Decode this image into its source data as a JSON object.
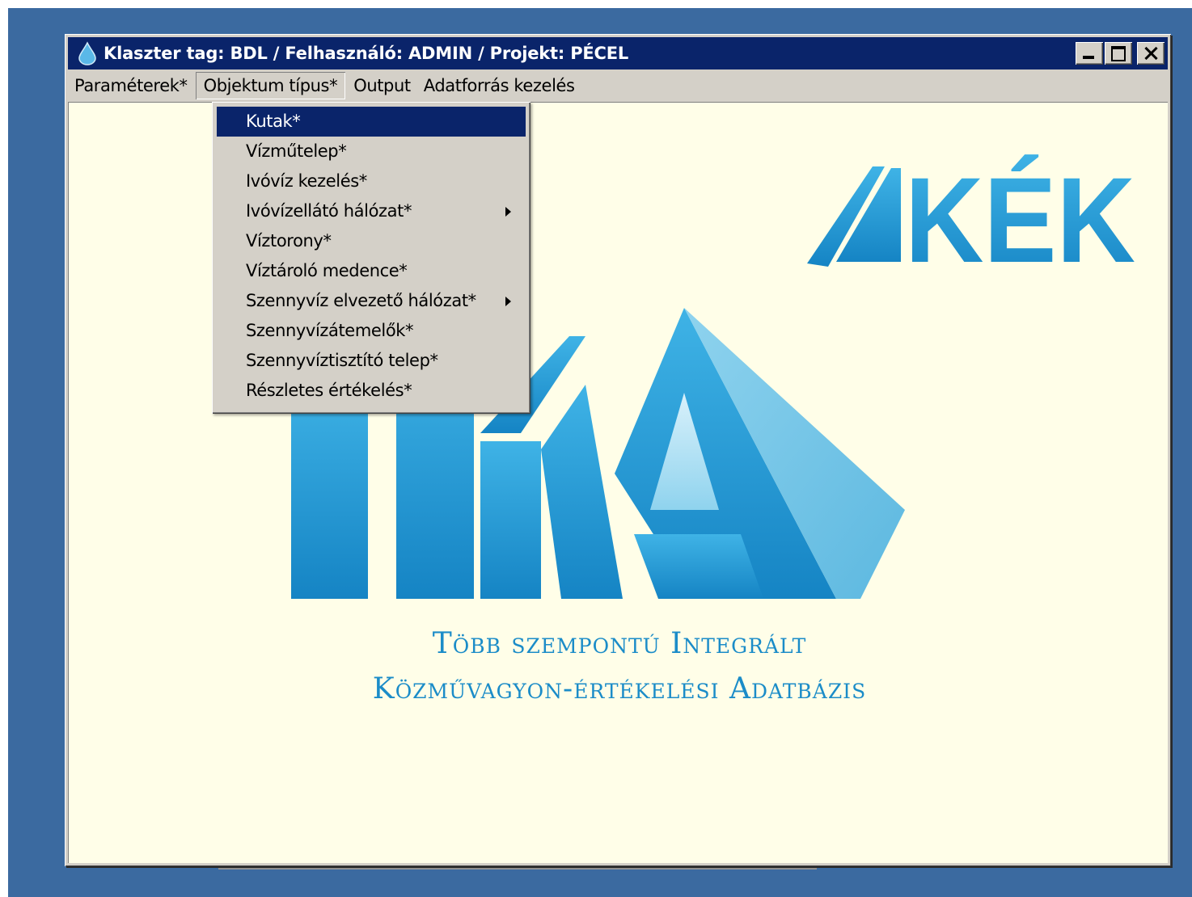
{
  "window": {
    "title": "Klaszter tag: BDL / Felhasználó: ADMIN / Projekt: PÉCEL"
  },
  "menubar": {
    "items": [
      "Paraméterek*",
      "Objektum típus*",
      "Output",
      "Adatforrás kezelés"
    ],
    "open_index": 1
  },
  "dropdown": {
    "items": [
      {
        "label": "Kutak*",
        "selected": true,
        "submenu": false
      },
      {
        "label": "Vízműtelep*",
        "selected": false,
        "submenu": false
      },
      {
        "label": "Ivóvíz kezelés*",
        "selected": false,
        "submenu": false
      },
      {
        "label": "Ivóvízellátó hálózat*",
        "selected": false,
        "submenu": true
      },
      {
        "label": "Víztorony*",
        "selected": false,
        "submenu": false
      },
      {
        "label": "Víztároló medence*",
        "selected": false,
        "submenu": false
      },
      {
        "label": "Szennyvíz elvezető hálózat*",
        "selected": false,
        "submenu": true
      },
      {
        "label": "Szennyvízátemelők*",
        "selected": false,
        "submenu": false
      },
      {
        "label": "Szennyvíztisztító telep*",
        "selected": false,
        "submenu": false
      },
      {
        "label": "Részletes értékelés*",
        "selected": false,
        "submenu": false
      }
    ]
  },
  "logo": {
    "top_word": "KÉK",
    "main_word": "TIKA",
    "subtitle_line1": "Több szempontú Integrált",
    "subtitle_line2": "Közművagyon-értékelési Adatbázis",
    "color": "#1b8cc8"
  },
  "colors": {
    "desktop": "#3b6aa0",
    "titlebar": "#0a246a",
    "client_bg": "#fffee8",
    "menu_bg": "#d4d0c8",
    "selection": "#0a246a",
    "logo_blue": "#1b8cc8"
  }
}
